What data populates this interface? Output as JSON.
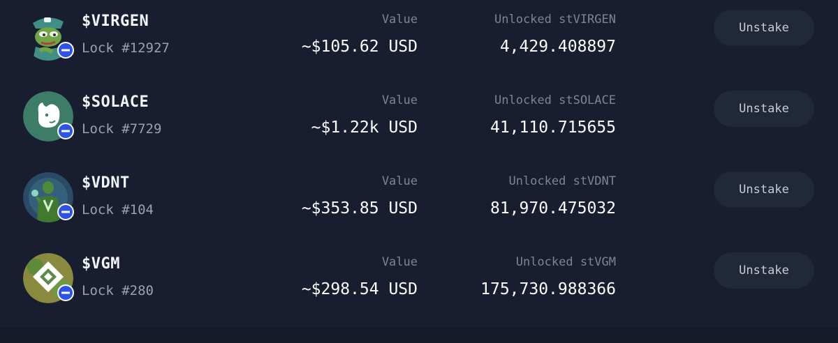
{
  "value_label": "Value",
  "unstake_label": "Unstake",
  "rows": [
    {
      "token": "$VIRGEN",
      "lock": "Lock #12927",
      "value": "~$105.62 USD",
      "unlocked_label": "Unlocked stVIRGEN",
      "unlocked_amount": "4,429.408897"
    },
    {
      "token": "$SOLACE",
      "lock": "Lock #7729",
      "value": "~$1.22k USD",
      "unlocked_label": "Unlocked stSOLACE",
      "unlocked_amount": "41,110.715655"
    },
    {
      "token": "$VDNT",
      "lock": "Lock #104",
      "value": "~$353.85 USD",
      "unlocked_label": "Unlocked stVDNT",
      "unlocked_amount": "81,970.475032"
    },
    {
      "token": "$VGM",
      "lock": "Lock #280",
      "value": "~$298.54 USD",
      "unlocked_label": "Unlocked stVGM",
      "unlocked_amount": "175,730.988366"
    }
  ],
  "icons": {
    "avatars": [
      "pepe-cap-avatar-icon",
      "solace-cat-avatar-icon",
      "vdnt-figure-avatar-icon",
      "vgm-diamond-avatar-icon"
    ],
    "chain_badge": "base-chain-icon"
  },
  "colors": {
    "background": "#181e2f",
    "button_bg": "#212838",
    "chain_badge_blue": "#2d52e6",
    "solace_green": "#3d7d68"
  }
}
